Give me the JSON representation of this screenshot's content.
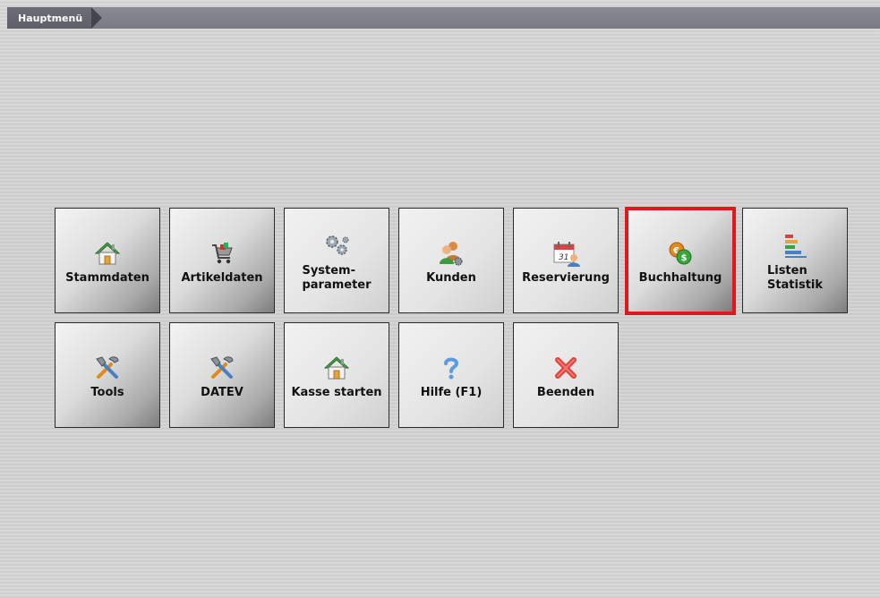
{
  "breadcrumb": {
    "label": "Hauptmenü"
  },
  "menu": {
    "row1": [
      {
        "label": "Stammdaten",
        "icon": "house-icon"
      },
      {
        "label": "Artikeldaten",
        "icon": "shopping-cart-icon"
      },
      {
        "label": "System-\nparameter",
        "icon": "gears-icon"
      },
      {
        "label": "Kunden",
        "icon": "customers-icon"
      },
      {
        "label": "Reservierung",
        "icon": "calendar-icon"
      },
      {
        "label": "Buchhaltung",
        "icon": "coins-icon",
        "selected": true
      },
      {
        "label": "Listen\nStatistik",
        "icon": "bar-list-icon"
      }
    ],
    "row2": [
      {
        "label": "Tools",
        "icon": "tools-icon"
      },
      {
        "label": "DATEV",
        "icon": "tools-icon"
      },
      {
        "label": "Kasse starten",
        "icon": "house-icon"
      },
      {
        "label": "Hilfe (F1)",
        "icon": "question-icon"
      },
      {
        "label": "Beenden",
        "icon": "close-icon"
      }
    ]
  },
  "colors": {
    "selection_border": "#e3161b",
    "topbar": "#7a7a84",
    "crumb": "#5f5f69"
  }
}
